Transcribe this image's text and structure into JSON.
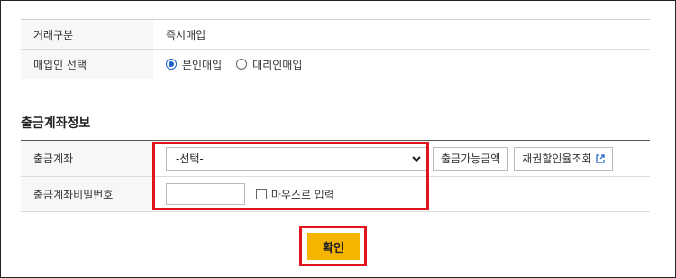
{
  "trade_info": {
    "type_label": "거래구분",
    "type_value": "즉시매입",
    "purchaser_label": "매입인 선택",
    "options": [
      "본인매입",
      "대리인매입"
    ],
    "selected_option": "본인매입"
  },
  "account_section": {
    "title": "출금계좌정보",
    "account_label": "출금계좌",
    "account_select_value": "-선택-",
    "available_amount_button": "출금가능금액",
    "bond_discount_button": "채권할인율조회",
    "password_label": "출금계좌비밀번호",
    "password_value": "",
    "mouse_input_label": "마우스로 입력"
  },
  "confirm_button": "확인",
  "colors": {
    "highlight": "#e0151c",
    "confirm_bg": "#f5b400",
    "radio_accent": "#1a5fcc",
    "label_bg": "#f7f7f7"
  },
  "icons": {
    "dropdown": "chevron-down-icon",
    "external_link": "external-link-icon"
  }
}
